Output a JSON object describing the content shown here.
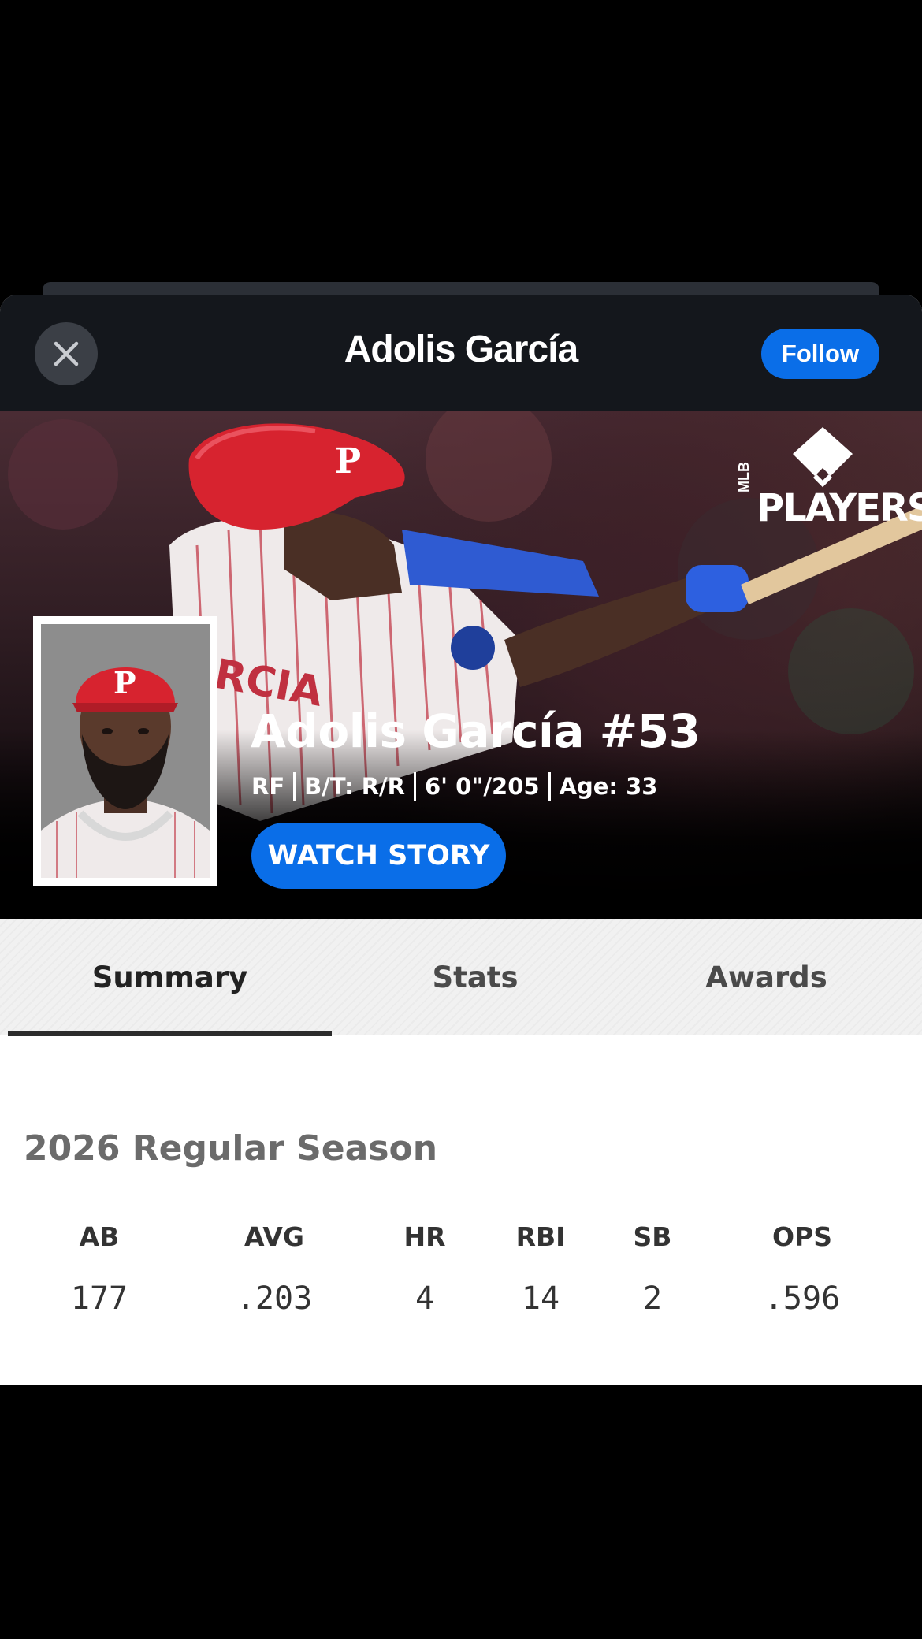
{
  "header": {
    "title": "Adolis García",
    "follow_label": "Follow"
  },
  "hero": {
    "brand": {
      "small": "MLB",
      "main": "PLAYERS"
    },
    "player_name": "Adolis García #53",
    "bio": [
      "RF",
      "B/T: R/R",
      "6' 0\"/205",
      "Age: 33"
    ],
    "watch_label": "WATCH STORY"
  },
  "tabs": [
    {
      "label": "Summary",
      "active": true
    },
    {
      "label": "Stats",
      "active": false
    },
    {
      "label": "Awards",
      "active": false
    }
  ],
  "summary": {
    "season_title": "2026 Regular Season",
    "stats": [
      {
        "label": "AB",
        "value": "177"
      },
      {
        "label": "AVG",
        "value": ".203"
      },
      {
        "label": "HR",
        "value": "4"
      },
      {
        "label": "RBI",
        "value": "14"
      },
      {
        "label": "SB",
        "value": "2"
      },
      {
        "label": "OPS",
        "value": ".596"
      }
    ]
  },
  "colors": {
    "accent": "#0a6ee8",
    "topbar": "#14171c"
  },
  "icons": [
    "close-icon",
    "mlb-players-logo"
  ]
}
